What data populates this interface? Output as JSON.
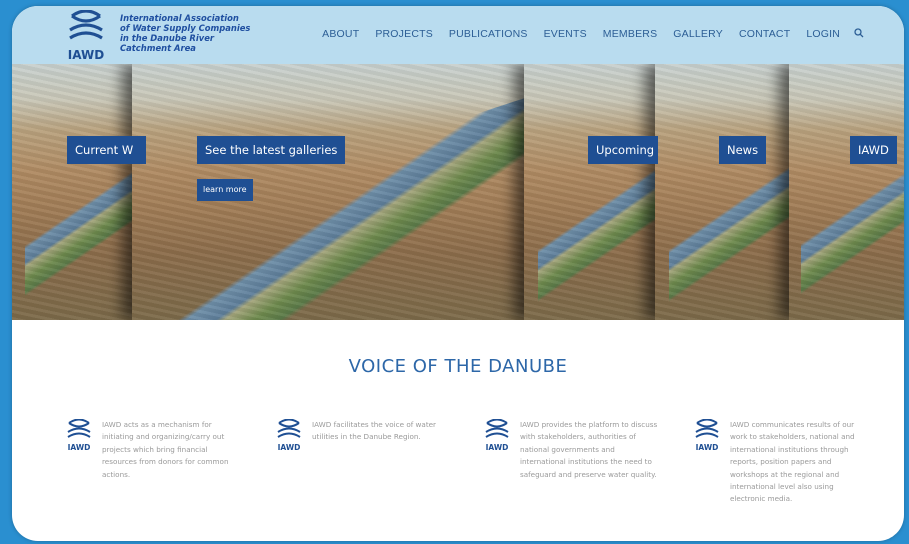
{
  "header": {
    "logo_abbr": "IAWD",
    "logo_lines": [
      "International Association",
      "of Water Supply Companies",
      "in the Danube River",
      "Catchment Area"
    ],
    "nav": [
      "ABOUT",
      "PROJECTS",
      "PUBLICATIONS",
      "EVENTS",
      "MEMBERS",
      "GALLERY",
      "CONTACT",
      "LOGIN"
    ],
    "search_icon": "search-icon"
  },
  "hero": {
    "slides": [
      {
        "label": "Current W"
      },
      {
        "label": "See the latest galleries",
        "button": "learn more"
      },
      {
        "label": "Upcoming"
      },
      {
        "label": "News"
      },
      {
        "label": "IAWD"
      }
    ]
  },
  "main": {
    "heading": "VOICE OF THE DANUBE",
    "features": [
      {
        "icon_label": "IAWD",
        "text": "IAWD acts as a mechanism for initiating and organizing/carry out projects which bring financial resources from donors for common actions."
      },
      {
        "icon_label": "IAWD",
        "text": "IAWD facilitates the voice of water utilities in the Danube Region."
      },
      {
        "icon_label": "IAWD",
        "text": "IAWD provides the platform to discuss with stakeholders, authorities of national governments and international institutions the need to safeguard and preserve water quality."
      },
      {
        "icon_label": "IAWD",
        "text": "IAWD communicates results of our work to stakeholders, national and international institutions through reports, position papers and workshops at the regional and international level also using electronic media."
      }
    ]
  },
  "colors": {
    "accent": "#1f4f93",
    "header_bg": "#b9dcef",
    "heading": "#2d67a8",
    "outer_bg": "#2a8fd0"
  }
}
